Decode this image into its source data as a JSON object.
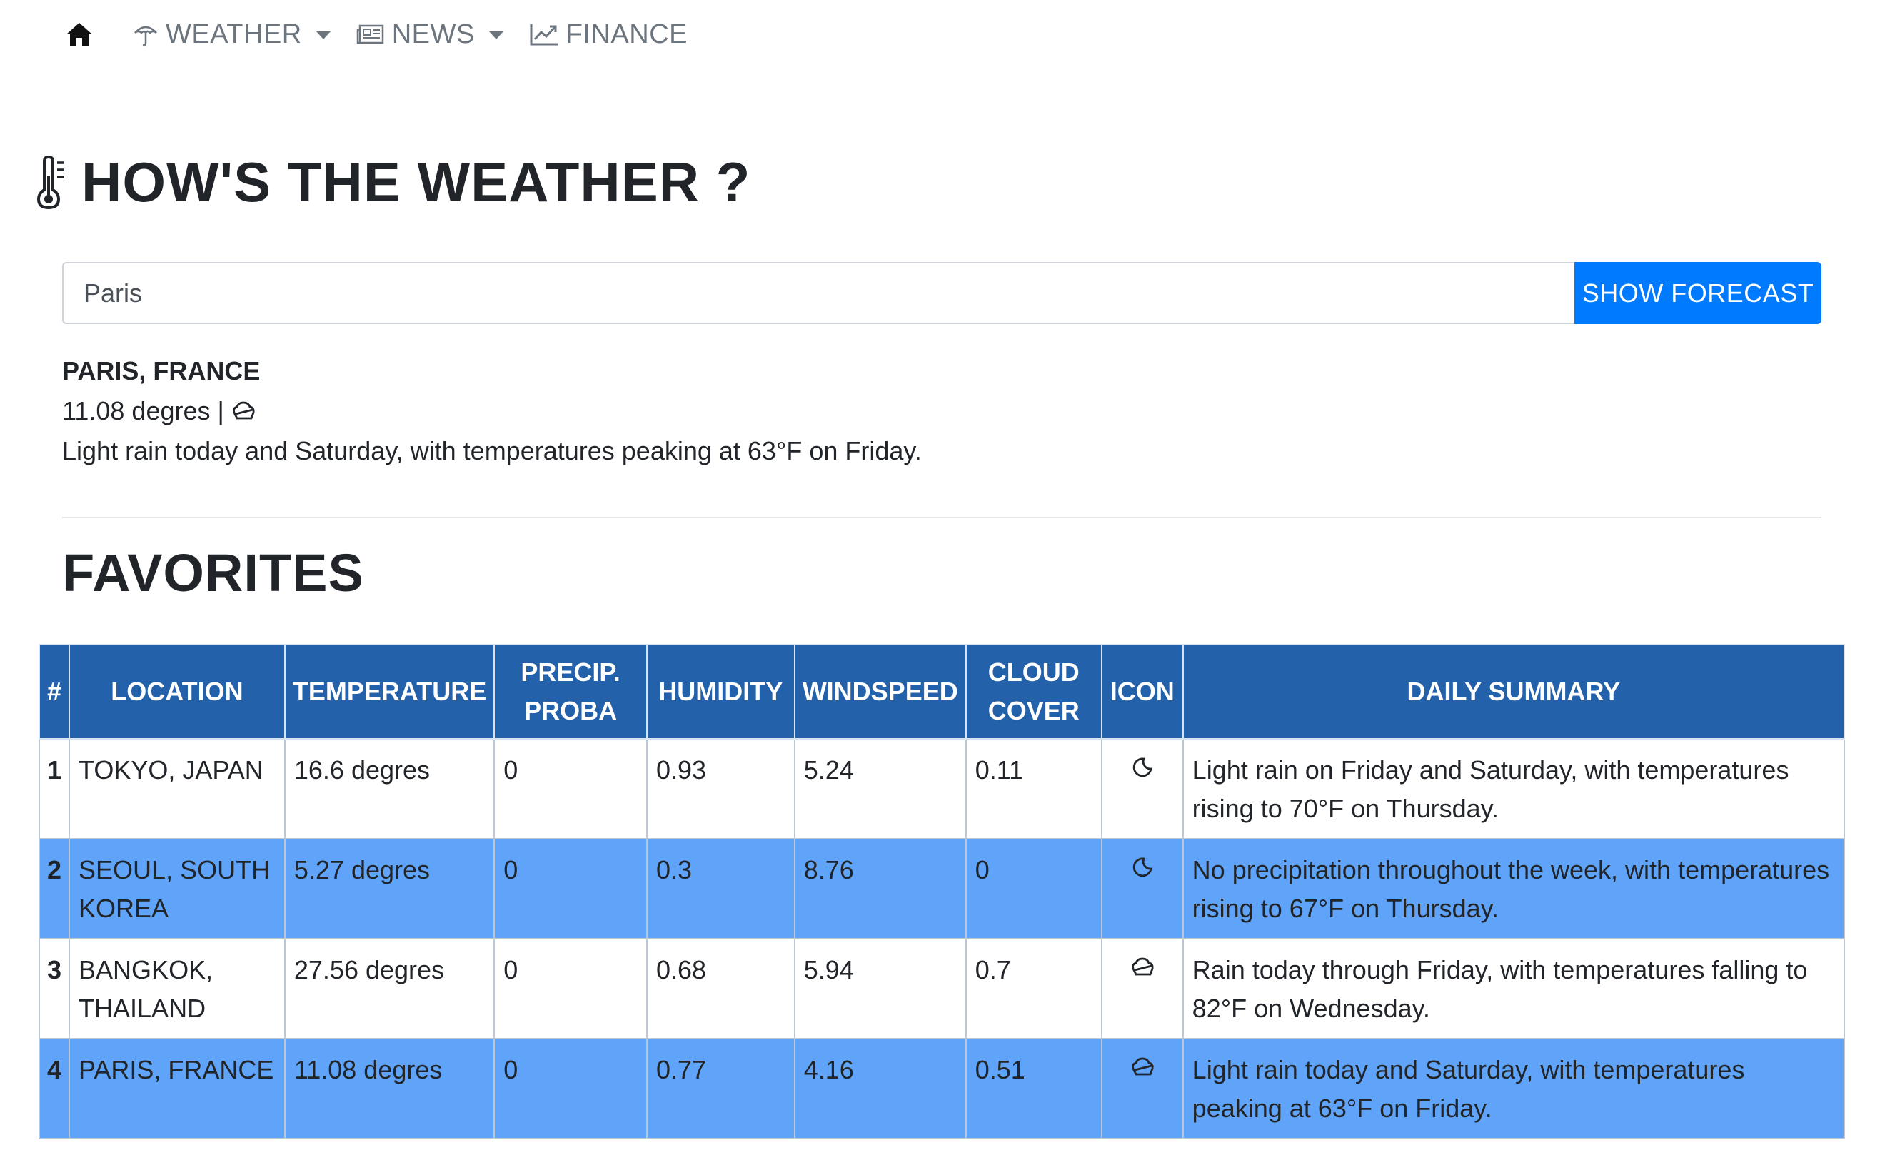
{
  "nav": {
    "home_icon": "home-icon",
    "items": [
      {
        "label": "WEATHER",
        "icon": "umbrella-icon",
        "dropdown": true
      },
      {
        "label": "NEWS",
        "icon": "newspaper-icon",
        "dropdown": true
      },
      {
        "label": "FINANCE",
        "icon": "chart-line-icon",
        "dropdown": false
      }
    ]
  },
  "header": {
    "title": "HOW'S THE WEATHER ?",
    "icon": "thermometer-icon"
  },
  "search": {
    "value": "Paris",
    "button_label": "SHOW FORECAST"
  },
  "current": {
    "city": "PARIS, FRANCE",
    "temperature": "11.08 degres",
    "separator": "|",
    "icon": "rain-cloud-icon",
    "summary": "Light rain today and Saturday, with temperatures peaking at 63°F on Friday."
  },
  "favorites": {
    "title": "FAVORITES",
    "columns": [
      "#",
      "LOCATION",
      "TEMPERATURE",
      "PRECIP. PROBA",
      "HUMIDITY",
      "WINDSPEED",
      "CLOUD COVER",
      "ICON",
      "DAILY SUMMARY"
    ],
    "rows": [
      {
        "num": "1",
        "location": "TOKYO, JAPAN",
        "temperature": "16.6 degres",
        "precip": "0",
        "humidity": "0.93",
        "windspeed": "5.24",
        "cloud": "0.11",
        "icon": "clear-night-icon",
        "summary": "Light rain on Friday and Saturday, with temperatures rising to 70°F on Thursday."
      },
      {
        "num": "2",
        "location": "SEOUL, SOUTH KOREA",
        "temperature": "5.27 degres",
        "precip": "0",
        "humidity": "0.3",
        "windspeed": "8.76",
        "cloud": "0",
        "icon": "clear-night-icon",
        "summary": "No precipitation throughout the week, with temperatures rising to 67°F on Thursday."
      },
      {
        "num": "3",
        "location": "BANGKOK, THAILAND",
        "temperature": "27.56 degres",
        "precip": "0",
        "humidity": "0.68",
        "windspeed": "5.94",
        "cloud": "0.7",
        "icon": "partly-cloudy-night-icon",
        "summary": "Rain today through Friday, with temperatures falling to 82°F on Wednesday."
      },
      {
        "num": "4",
        "location": "PARIS, FRANCE",
        "temperature": "11.08 degres",
        "precip": "0",
        "humidity": "0.77",
        "windspeed": "4.16",
        "cloud": "0.51",
        "icon": "partly-cloudy-night-icon",
        "summary": "Light rain today and Saturday, with temperatures peaking at 63°F on Friday."
      }
    ]
  },
  "colors": {
    "header_bg": "#2461ab",
    "alt_row_bg": "#5fa4f8",
    "button_bg": "#007bff"
  }
}
